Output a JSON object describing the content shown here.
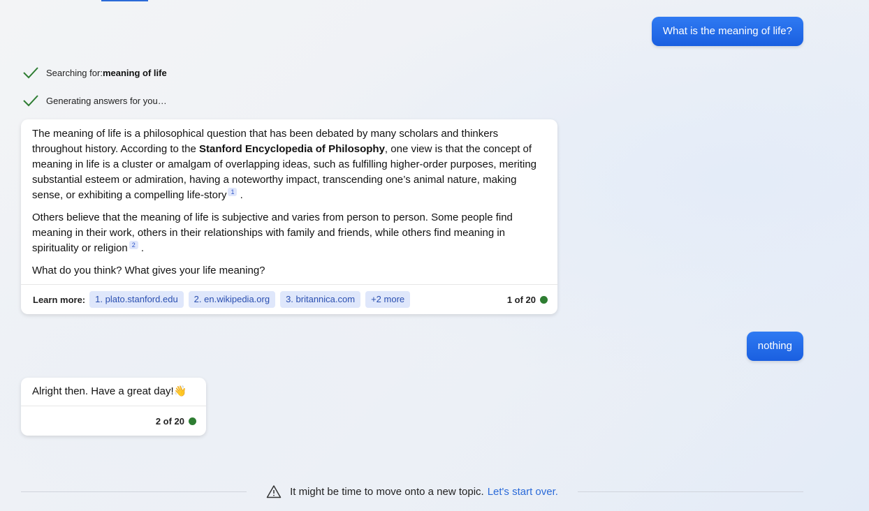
{
  "conversation": {
    "user_message_1": "What is the meaning of life?",
    "status_1": {
      "prefix": "Searching for: ",
      "query": "meaning of life"
    },
    "status_2": "Generating answers for you…",
    "answer_1": {
      "p1_before": "The meaning of life is a philosophical question that has been debated by many scholars and thinkers throughout history. According to the ",
      "p1_bold": "Stanford Encyclopedia of Philosophy",
      "p1_after": ", one view is that the concept of meaning in life is a cluster or amalgam of overlapping ideas, such as fulfilling higher-order purposes, meriting substantial esteem or admiration, having a noteworthy impact, transcending one’s animal nature, making sense, or exhibiting a compelling life-story",
      "p1_cite": "1",
      "p2": "Others believe that the meaning of life is subjective and varies from person to person. Some people find meaning in their work, others in their relationships with family and friends, while others find meaning in spirituality or religion",
      "p2_cite": "2",
      "p3": "What do you think? What gives your life meaning?",
      "period": ".",
      "learn_more_label": "Learn more:",
      "sources": [
        "1. plato.stanford.edu",
        "2. en.wikipedia.org",
        "3. britannica.com",
        "+2 more"
      ],
      "counter": "1 of 20"
    },
    "user_message_2": "nothing",
    "answer_2": {
      "text": "Alright then. Have a great day!👋",
      "counter": "2 of 20"
    }
  },
  "notice": {
    "text": "It might be time to move onto a new topic.",
    "link": "Let's start over."
  },
  "colors": {
    "accent": "#2a6ad8",
    "user_bubble": "#1a5fe0",
    "check": "#2e7d32",
    "status_dot": "#2e7d32",
    "chip_bg": "#dfe7fb"
  },
  "icons": [
    "check-icon",
    "warning-triangle-icon"
  ]
}
